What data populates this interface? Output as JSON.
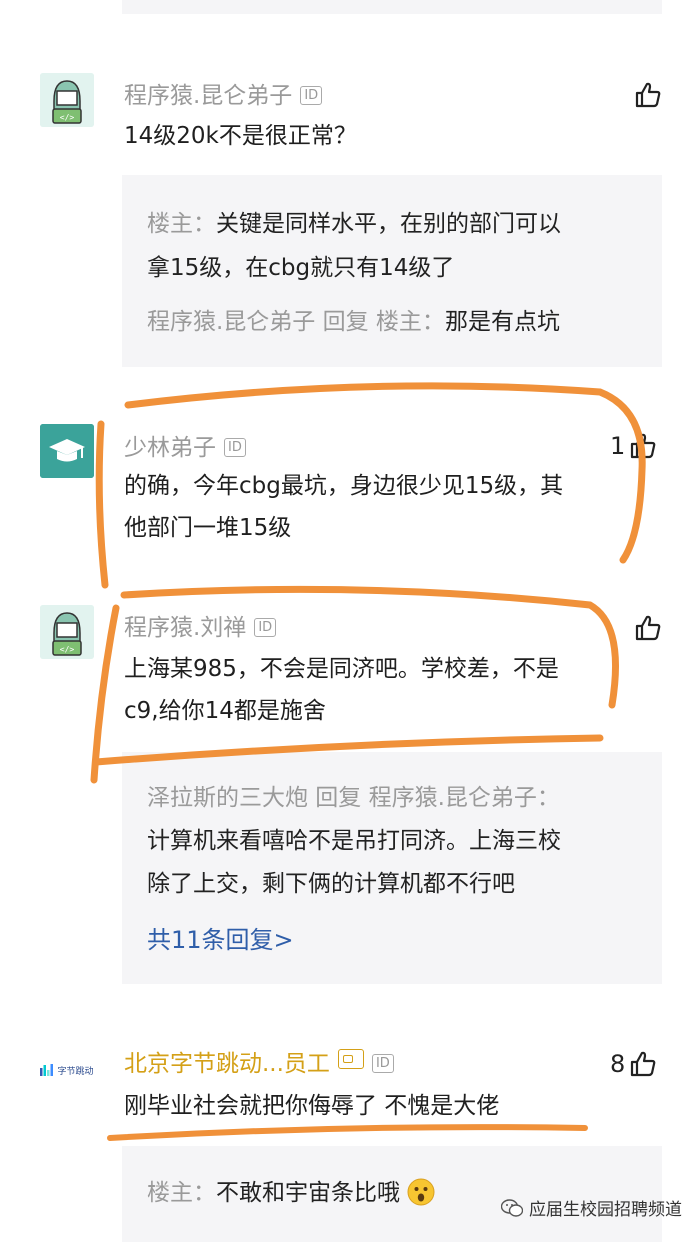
{
  "comments": [
    {
      "username": "程序猿.昆仑弟子",
      "id_badge": "ID",
      "text": "14级20k不是很正常？",
      "likes": "",
      "replies": [
        {
          "who": "楼主：",
          "text": "关键是同样水平，在别的部门可以"
        },
        {
          "text": "拿15级，在cbg就只有14级了"
        },
        {
          "who": "程序猿.昆仑弟子 回复 楼主：",
          "text": "那是有点坑"
        }
      ]
    },
    {
      "username": "少林弟子",
      "id_badge": "ID",
      "text_lines": [
        "的确，今年cbg最坑，身边很少见15级，其",
        "他部门一堆15级"
      ],
      "likes": "1"
    },
    {
      "username": "程序猿.刘禅",
      "id_badge": "ID",
      "text_lines": [
        "上海某985，不会是同济吧。学校差，不是",
        "c9,给你14都是施舍"
      ],
      "likes": "",
      "replies": [
        {
          "who": "泽拉斯的三大炮 回复 程序猿.昆仑弟子："
        },
        {
          "text": "计算机来看嘻哈不是吊打同济。上海三校"
        },
        {
          "text": "除了上交，剩下俩的计算机都不行吧"
        }
      ],
      "more_replies": "共11条回复>"
    },
    {
      "username": "北京字节跳动...员工",
      "id_badge": "ID",
      "avatar_text": "字节跳动",
      "text": "刚毕业社会就把你侮辱了 不愧是大佬",
      "likes": "8",
      "replies": [
        {
          "who": "楼主：",
          "text": "不敢和宇宙条比哦"
        }
      ]
    }
  ],
  "watermark": "应届生校园招聘频道",
  "colors": {
    "annotation": "#f0913a",
    "link": "#2f5ea9",
    "gold": "#d4a017",
    "reply_bg": "#f5f5f7"
  }
}
